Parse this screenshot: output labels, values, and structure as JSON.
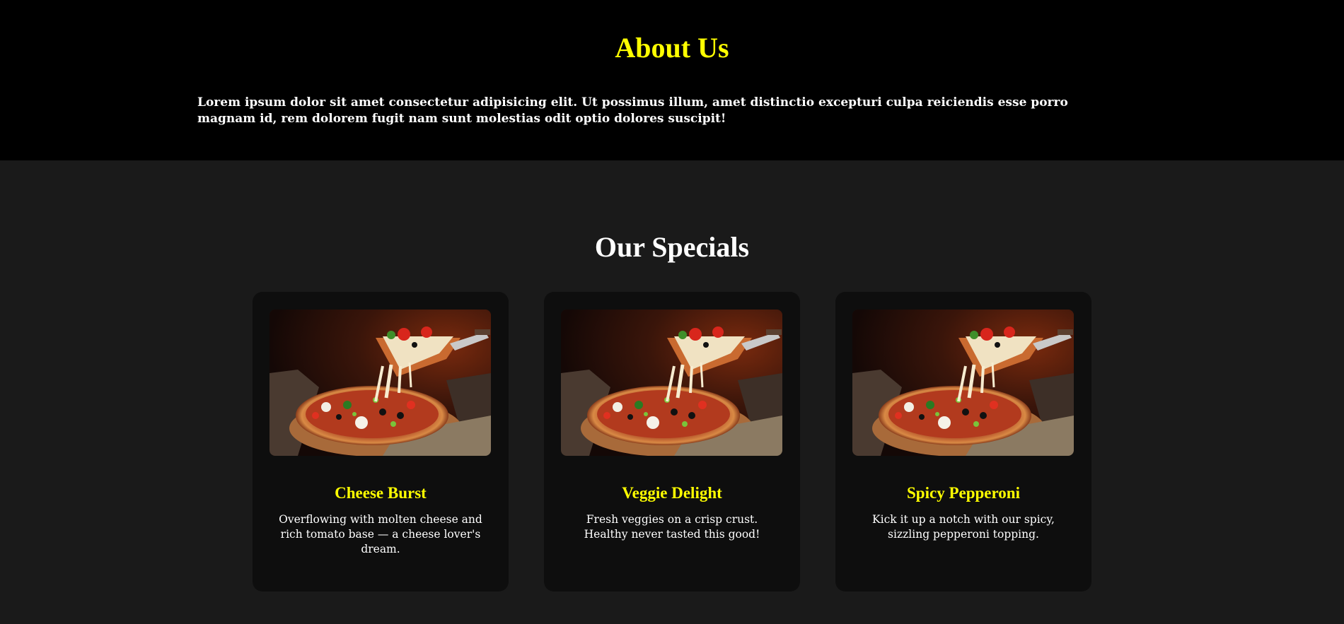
{
  "about": {
    "title": "About Us",
    "text": "Lorem ipsum dolor sit amet consectetur adipisicing elit. Ut possimus illum, amet distinctio excepturi culpa reiciendis esse porro magnam id, rem dolorem fugit nam sunt molestias odit optio dolores suscipit!"
  },
  "specials": {
    "title": "Our Specials",
    "items": [
      {
        "name": "Cheese Burst",
        "description": "Overflowing with molten cheese and rich tomato base — a cheese lover's dream.",
        "image_icon": "pizza-photo"
      },
      {
        "name": "Veggie Delight",
        "description": "Fresh veggies on a crisp crust. Healthy never tasted this good!",
        "image_icon": "pizza-photo"
      },
      {
        "name": "Spicy Pepperoni",
        "description": "Kick it up a notch with our spicy, sizzling pepperoni topping.",
        "image_icon": "pizza-photo"
      }
    ]
  },
  "colors": {
    "accent": "#ffff00",
    "about_bg": "#000000",
    "page_bg": "#1a1a1a",
    "card_bg": "#0e0e0e"
  }
}
